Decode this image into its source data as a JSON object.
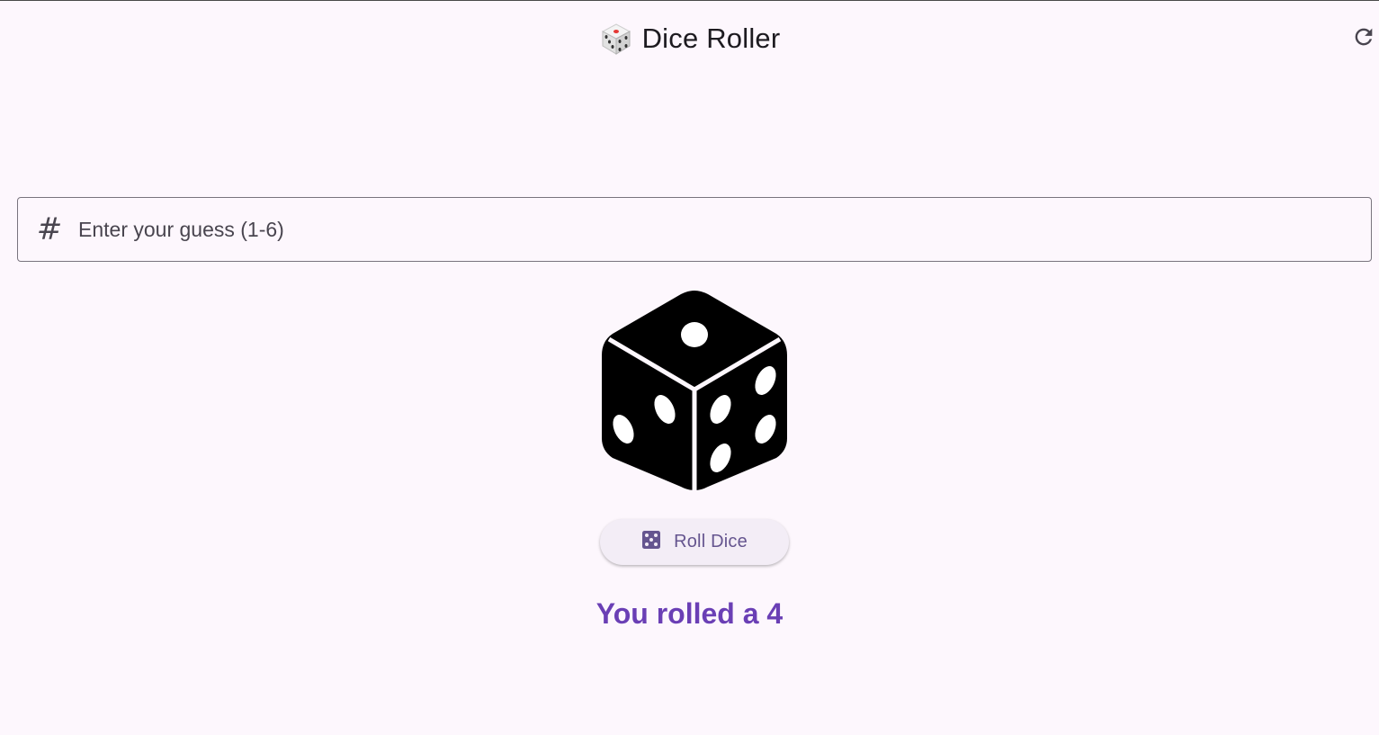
{
  "appbar": {
    "title": "Dice Roller",
    "title_icon": "game-die-emoji",
    "action_icon": "refresh-icon"
  },
  "guess_field": {
    "prefix_icon": "hash-icon",
    "placeholder": "Enter your guess (1-6)",
    "value": ""
  },
  "die": {
    "icon": "dice-3d-icon",
    "face_value": 4
  },
  "roll_button": {
    "icon": "dice-five-icon",
    "label": "Roll Dice"
  },
  "result": {
    "text": "You rolled a 4"
  },
  "colors": {
    "background": "#fdf7fd",
    "accent": "#6a3fb5",
    "button_bg": "#f3edf6",
    "button_text": "#65558f",
    "outline": "#79747e"
  }
}
